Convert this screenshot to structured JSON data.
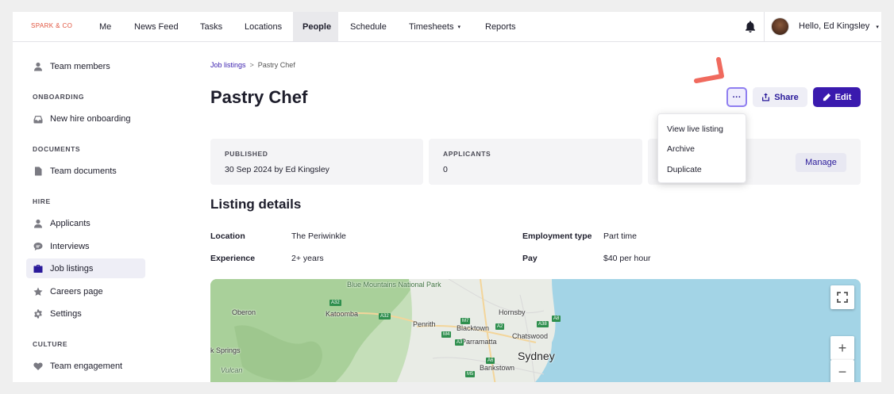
{
  "brand": {
    "logo_text": "SPARK & CO"
  },
  "topnav": {
    "items": [
      {
        "label": "Me"
      },
      {
        "label": "News Feed"
      },
      {
        "label": "Tasks"
      },
      {
        "label": "Locations"
      },
      {
        "label": "People",
        "active": true
      },
      {
        "label": "Schedule"
      },
      {
        "label": "Timesheets",
        "has_dropdown": true
      },
      {
        "label": "Reports"
      }
    ],
    "user_name": "Hello, Ed Kingsley",
    "bell_icon": "bell-icon",
    "caret_glyph": "▾"
  },
  "sidebar": {
    "items": [
      {
        "label": "Team members",
        "icon": "person-icon"
      },
      {
        "label": "New hire onboarding",
        "icon": "inbox-icon"
      },
      {
        "label": "Team documents",
        "icon": "document-icon"
      },
      {
        "label": "Applicants",
        "icon": "person-icon"
      },
      {
        "label": "Interviews",
        "icon": "chat-icon"
      },
      {
        "label": "Job listings",
        "icon": "briefcase-icon",
        "active": true
      },
      {
        "label": "Careers page",
        "icon": "star-icon"
      },
      {
        "label": "Settings",
        "icon": "gear-icon"
      },
      {
        "label": "Team engagement",
        "icon": "heart-icon"
      }
    ],
    "sections": {
      "onboarding": "ONBOARDING",
      "documents": "DOCUMENTS",
      "hire": "HIRE",
      "culture": "CULTURE"
    }
  },
  "breadcrumb": {
    "parent": "Job listings",
    "separator": ">",
    "current": "Pastry Chef"
  },
  "page": {
    "title": "Pastry Chef"
  },
  "actions": {
    "more_label": "···",
    "share_label": "Share",
    "edit_label": "Edit"
  },
  "dropdown": {
    "items": [
      "View live listing",
      "Archive",
      "Duplicate"
    ]
  },
  "stats": {
    "published_label": "PUBLISHED",
    "published_value": "30 Sep 2024 by Ed Kingsley",
    "applicants_label": "APPLICANTS",
    "applicants_value": "0",
    "manage_label": "Manage"
  },
  "details": {
    "section_title": "Listing details",
    "location_label": "Location",
    "location_value": "The Periwinkle",
    "experience_label": "Experience",
    "experience_value": "2+ years",
    "employment_label": "Employment type",
    "employment_value": "Part time",
    "pay_label": "Pay",
    "pay_value": "$40 per hour"
  },
  "map": {
    "labels": {
      "blue_mountains": "Blue Mountains National Park",
      "oberon": "Oberon",
      "katoomba": "Katoomba",
      "penrith": "Penrith",
      "blacktown": "Blacktown",
      "hornsby": "Hornsby",
      "parramatta": "Parramatta",
      "chatswood": "Chatswood",
      "sydney": "Sydney",
      "bankstown": "Bankstown",
      "springs": "k Springs",
      "vulcan": "Vulcan"
    },
    "roads": [
      "A32",
      "A32",
      "M7",
      "A2",
      "A38",
      "A8",
      "M4",
      "A3",
      "M5",
      "A6"
    ],
    "controls": {
      "fullscreen": "⛶",
      "zoom_in": "+",
      "zoom_out": "−"
    }
  },
  "colors": {
    "accent": "#3a1aae",
    "logo": "#e0533d",
    "annotation": "#f06a5e",
    "water": "#a3d4e6"
  }
}
